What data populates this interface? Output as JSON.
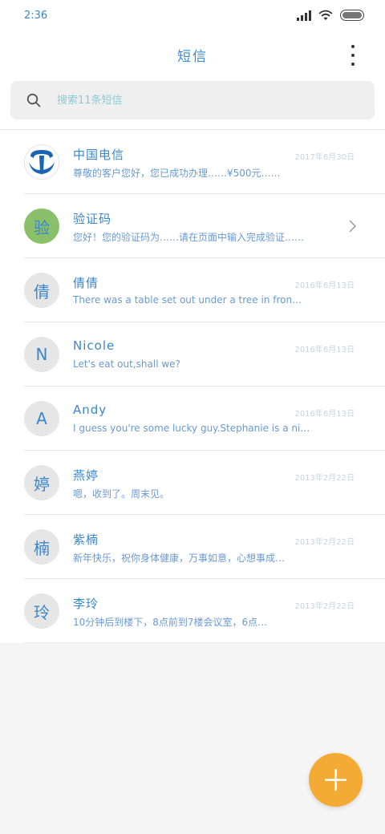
{
  "status_bar": {
    "time": "2:36"
  },
  "header": {
    "title": "短信"
  },
  "search": {
    "placeholder": "搜索11条短信"
  },
  "colors": {
    "accent": "#3b8bd4",
    "fab": "#f4ab35",
    "avatar_green": "#8bc06a",
    "list_bg": "#ffffff",
    "page_bg": "#f5f5f5"
  },
  "messages": [
    {
      "avatar_icon": "china-telecom-logo",
      "avatar_text": "",
      "sender": "中国电信",
      "preview": "尊敬的客户您好，您已成功办理……¥500元……",
      "time": "2017年6月30日"
    },
    {
      "avatar_icon": "letter-avatar",
      "avatar_text": "验",
      "sender": "验证码",
      "preview": "您好！您的验证码为……请在页面中输入完成验证……",
      "time": ""
    },
    {
      "avatar_icon": "letter-avatar",
      "avatar_text": "倩",
      "sender": "倩倩",
      "preview": "There was a table set out under a tree in fron…",
      "time": "2016年6月13日"
    },
    {
      "avatar_icon": "letter-avatar",
      "avatar_text": "N",
      "sender": "Nicole",
      "preview": "Let's eat out,shall we?",
      "time": "2016年6月13日"
    },
    {
      "avatar_icon": "letter-avatar",
      "avatar_text": "A",
      "sender": "Andy",
      "preview": "I guess you're some lucky guy.Stephanie is a ni…",
      "time": "2016年6月13日"
    },
    {
      "avatar_icon": "letter-avatar",
      "avatar_text": "婷",
      "sender": "燕婷",
      "preview": "嗯，收到了。周末见。",
      "time": "2013年2月22日"
    },
    {
      "avatar_icon": "letter-avatar",
      "avatar_text": "楠",
      "sender": "紫楠",
      "preview": "新年快乐，祝你身体健康，万事如意，心想事成…",
      "time": "2013年2月22日"
    },
    {
      "avatar_icon": "letter-avatar",
      "avatar_text": "玲",
      "sender": "李玲",
      "preview": "10分钟后到楼下，8点前到7楼会议室，6点…",
      "time": "2013年2月22日"
    }
  ]
}
